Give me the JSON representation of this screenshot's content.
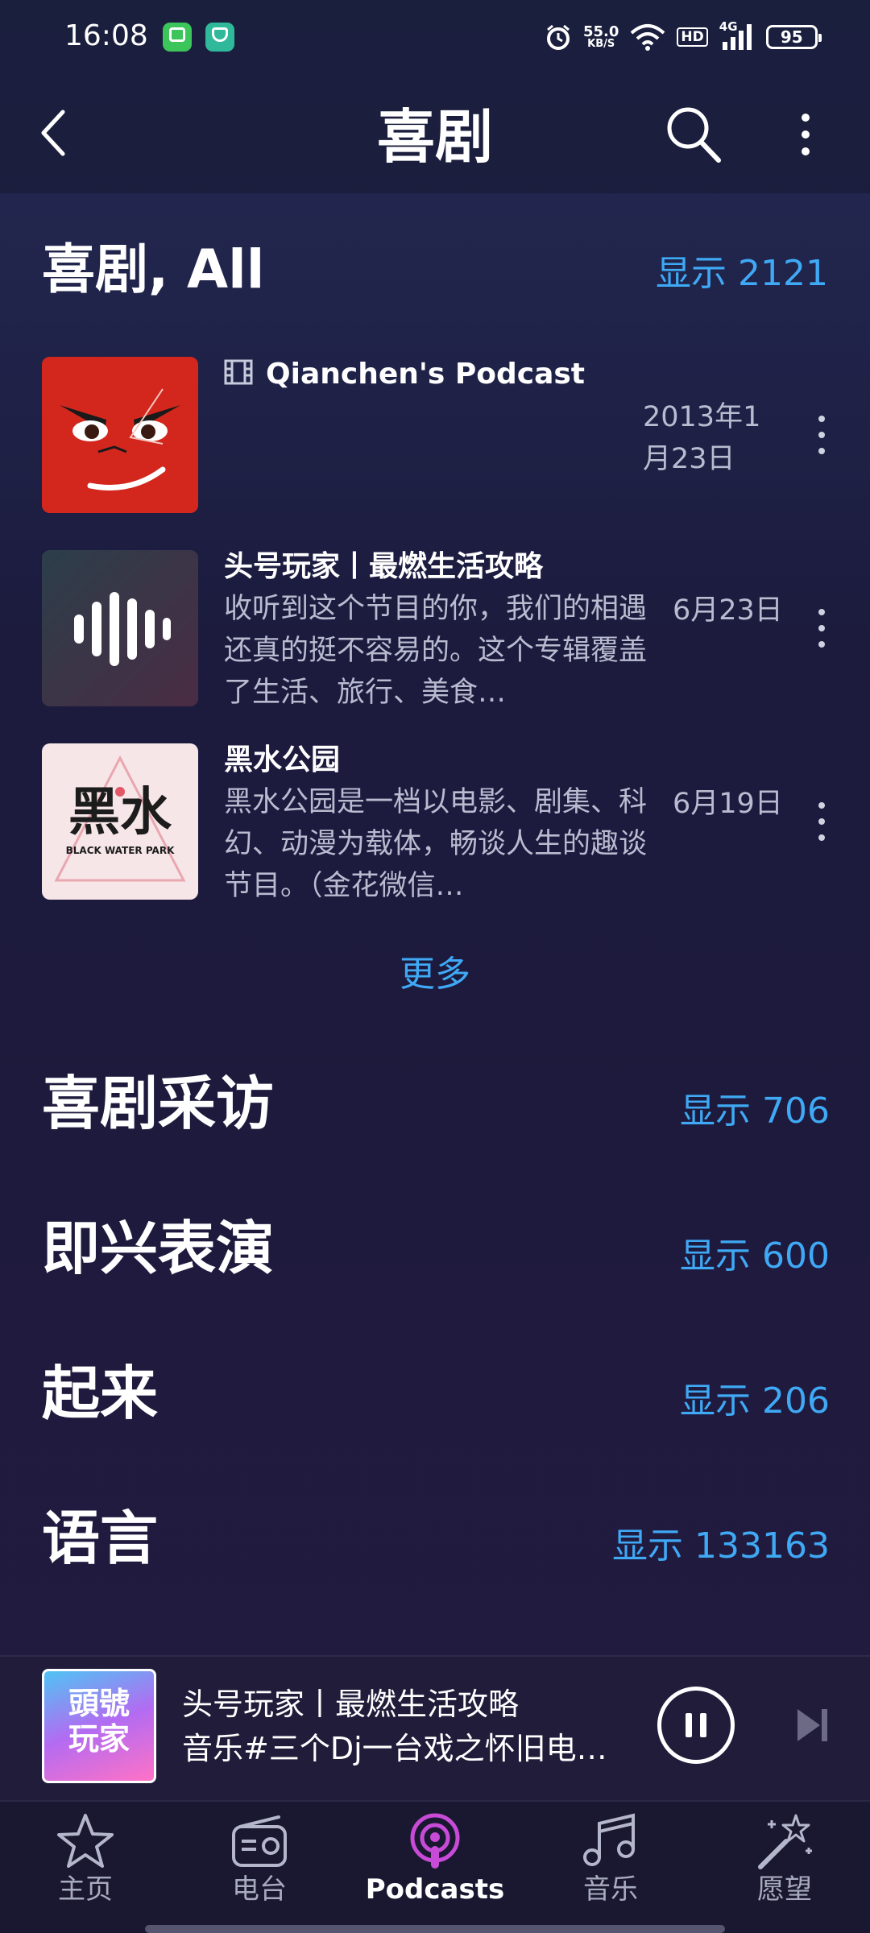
{
  "status_bar": {
    "time": "16:08",
    "net_speed_value": "55.0",
    "net_speed_unit": "KB/S",
    "hd_badge": "HD",
    "network_type": "4G",
    "battery": "95",
    "icons": [
      "message-app-icon",
      "shield-app-icon",
      "alarm-icon",
      "wifi-icon",
      "signal-icon",
      "battery-icon"
    ]
  },
  "header": {
    "title": "喜剧",
    "icons": [
      "back-arrow-icon",
      "search-icon",
      "more-vertical-icon"
    ]
  },
  "section": {
    "title": "喜剧, All",
    "show_all": "显示 2121"
  },
  "episodes": [
    {
      "title": "Qianchen's Podcast",
      "description": "",
      "date": "2013年1月23日",
      "badge_icon": "video-film-icon",
      "thumb_colors": [
        "#d3271e",
        "#1a1a1a"
      ]
    },
    {
      "title": "头号玩家丨最燃生活攻略",
      "description": "收听到这个节目的你，我们的相遇还真的挺不容易的。这个专辑覆盖了生活、旅行、美食…",
      "date": "6月23日",
      "thumb_colors": [
        "#3a3a50",
        "#ffffff"
      ]
    },
    {
      "title": "黑水公园",
      "description": "黑水公园是一档以电影、剧集、科幻、动漫为载体，畅谈人生的趣谈节目。（金花微信…",
      "date": "6月19日",
      "thumb_text": "黑水",
      "thumb_subtext": "BLACK WATER PARK",
      "thumb_colors": [
        "#f6e6e8",
        "#1c1c1c"
      ]
    }
  ],
  "more_link": "更多",
  "categories": [
    {
      "title": "喜剧采访",
      "count": "显示 706"
    },
    {
      "title": "即兴表演",
      "count": "显示 600"
    },
    {
      "title": "起来",
      "count": "显示 206"
    },
    {
      "title": "语言",
      "count": "显示 133163"
    }
  ],
  "player": {
    "title": "头号玩家丨最燃生活攻略",
    "subtitle": "音乐#三个Dj一台戏之怀旧电…",
    "art_text": "頭號玩家",
    "icons": [
      "pause-icon",
      "skip-next-icon"
    ]
  },
  "tabs": [
    {
      "label": "主页",
      "icon": "star-icon",
      "active": false
    },
    {
      "label": "电台",
      "icon": "radio-icon",
      "active": false
    },
    {
      "label": "Podcasts",
      "icon": "podcast-icon",
      "active": true
    },
    {
      "label": "音乐",
      "icon": "music-note-icon",
      "active": false
    },
    {
      "label": "愿望",
      "icon": "magic-wand-icon",
      "active": false
    }
  ],
  "colors": {
    "accent": "#3fa9f5",
    "active_tab_icon": "#c84bd8",
    "background": "#1b1b3c"
  }
}
